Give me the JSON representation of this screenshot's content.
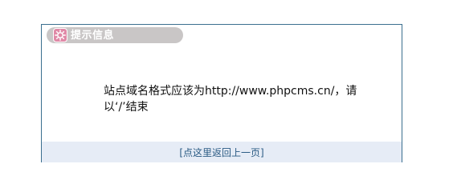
{
  "dialog": {
    "title": "提示信息",
    "icon": "gear-icon",
    "message": "站点域名格式应该为http://www.phpcms.cn/，请以‘/’结束",
    "back_link": "[点这里返回上一页]"
  },
  "colors": {
    "border": "#3b6f8f",
    "title_pill": "#c9c6c6",
    "icon_bg": "#e089a7",
    "footer_bg": "#e6ecf6",
    "link": "#2b5b84"
  }
}
